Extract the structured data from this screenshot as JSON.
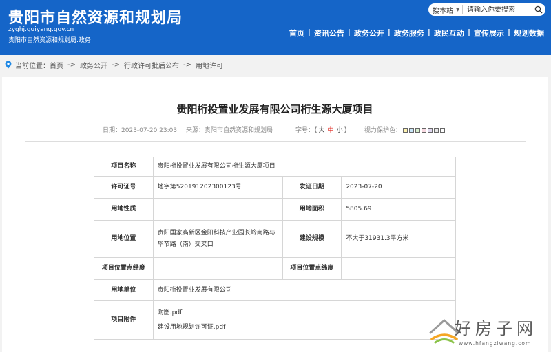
{
  "header": {
    "title": "贵阳市自然资源和规划局",
    "domain": "zyghj.guiyang.gov.cn",
    "subtitle": "贵阳市自然资源和规划局.政务",
    "bg_color": "#1565c8"
  },
  "search": {
    "scope": "搜本站",
    "placeholder": "请输入你要搜索",
    "icon": "search-icon"
  },
  "nav": {
    "items": [
      "首页",
      "资讯公告",
      "政务公开",
      "政务服务",
      "政民互动",
      "宣传展示",
      "规划数据"
    ]
  },
  "breadcrumb": {
    "prefix": "当前位置：",
    "items": [
      "首页",
      "政务公开",
      "行政许可批后公布",
      "用地许可"
    ],
    "separator": "->"
  },
  "article": {
    "title": "贵阳桁投置业发展有限公司桁生源大厦项目",
    "date_label": "日期：",
    "date": "2023-07-20 23:03",
    "source_label": "来源：",
    "source": "贵阳市自然资源和规划局",
    "font_label": "字号：",
    "font_sizes": [
      "大",
      "中",
      "小"
    ],
    "bracket_open": "【",
    "bracket_close": "】",
    "vision_label": "视力保护色：",
    "vision_colors": [
      "#fff3b0",
      "#c8e6f8",
      "#d8f0d0",
      "#f7d8e0",
      "#e0d8f0",
      "#e8e8e8",
      "#ffffff"
    ]
  },
  "table": {
    "project_name_label": "项目名称",
    "project_name": "贵阳桁投置业发展有限公司桁生源大厦项目",
    "permit_no_label": "许可证号",
    "permit_no": "地字第520191202300123号",
    "issue_date_label": "发证日期",
    "issue_date": "2023-07-20",
    "land_nature_label": "用地性质",
    "land_nature": "",
    "land_area_label": "用地面积",
    "land_area": "5805.69",
    "location_label": "用地位置",
    "location": "贵阳国家高新区金阳科技产业园长岭南路与毕节路（南）交叉口",
    "scale_label": "建设规模",
    "scale": "不大于31931.3平方米",
    "longitude_label": "项目位置点经度",
    "longitude": "",
    "latitude_label": "项目位置点纬度",
    "latitude": "",
    "unit_label": "用地单位",
    "unit": "贵阳桁投置业发展有限公司",
    "attachment_label": "项目附件",
    "attachments": [
      "附图.pdf",
      "建设用地规划许可证.pdf"
    ]
  },
  "watermark": {
    "text": "好房子网",
    "url": "www.hfangziwang.com"
  }
}
